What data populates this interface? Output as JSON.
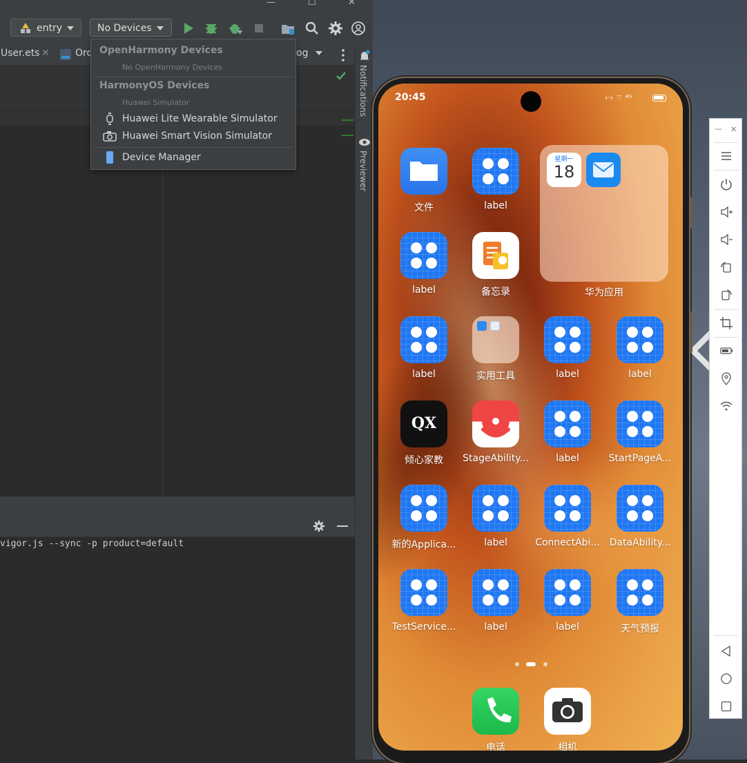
{
  "ide": {
    "window_controls": {
      "minimize": "—",
      "maximize": "☐",
      "close": "✕"
    },
    "toolbar": {
      "module_selector": "entry",
      "device_selector": "No Devices"
    },
    "tabs": [
      {
        "label": "User.ets",
        "close": "✕"
      },
      {
        "label": "Ord"
      },
      {
        "label": "og"
      }
    ],
    "device_dropdown": {
      "openharmony_header": "OpenHarmony Devices",
      "openharmony_empty": "No OpenHarmony Devices",
      "harmonyos_header": "HarmonyOS Devices",
      "harmonyos_subheader": "Huawei Simulator",
      "items": [
        {
          "label": "Huawei Lite Wearable Simulator",
          "icon": "watch-icon"
        },
        {
          "label": "Huawei Smart Vision Simulator",
          "icon": "camera-icon"
        }
      ],
      "device_manager": "Device Manager"
    },
    "right_sidebar": {
      "notifications": "Notifications",
      "previewer": "Previewer"
    },
    "terminal": {
      "command_text": "vigor.js --sync -p product=default"
    }
  },
  "phone": {
    "status_bar": {
      "time": "20:45",
      "icons": "‹·› ⌔ ⁴ᴳ"
    },
    "folder_large": {
      "name": "华为应用",
      "calendar_weekday": "星期一",
      "calendar_day": "18"
    },
    "apps": [
      {
        "name": "文件",
        "kind": "files"
      },
      {
        "name": "label",
        "kind": "grid"
      },
      {
        "name": "label",
        "kind": "grid"
      },
      {
        "name": "备忘录",
        "kind": "memo"
      },
      {
        "name": "label",
        "kind": "grid"
      },
      {
        "name": "实用工具",
        "kind": "folder"
      },
      {
        "name": "label",
        "kind": "grid"
      },
      {
        "name": "label",
        "kind": "grid"
      },
      {
        "name": "倾心家教",
        "kind": "qx",
        "tile_text": "QX"
      },
      {
        "name": "StageAbility...",
        "kind": "smile"
      },
      {
        "name": "label",
        "kind": "grid"
      },
      {
        "name": "StartPageA...",
        "kind": "grid"
      },
      {
        "name": "新的Applica...",
        "kind": "grid"
      },
      {
        "name": "label",
        "kind": "grid"
      },
      {
        "name": "ConnectAbi...",
        "kind": "grid"
      },
      {
        "name": "DataAbility...",
        "kind": "grid"
      },
      {
        "name": "TestService...",
        "kind": "grid"
      },
      {
        "name": "label",
        "kind": "grid"
      },
      {
        "name": "label",
        "kind": "grid"
      },
      {
        "name": "天气预报",
        "kind": "grid"
      }
    ],
    "dock": [
      {
        "name": "电话",
        "kind": "phone"
      },
      {
        "name": "相机",
        "kind": "camera"
      }
    ],
    "page_indicator": {
      "pages": 3,
      "current": 2
    }
  },
  "emulator_panel": {
    "minimize": "—",
    "close": "✕",
    "buttons": [
      "menu-icon",
      "power-icon",
      "volume-up-icon",
      "volume-down-icon",
      "rotate-icon",
      "rotate-alt-icon",
      "crop-icon",
      "battery-icon",
      "location-icon",
      "wifi-icon",
      "back-icon",
      "home-icon",
      "recents-icon"
    ]
  },
  "colors": {
    "ide_bg": "#2b2b2b",
    "app_blue": "#1f77f2",
    "run_green": "#59a869"
  }
}
